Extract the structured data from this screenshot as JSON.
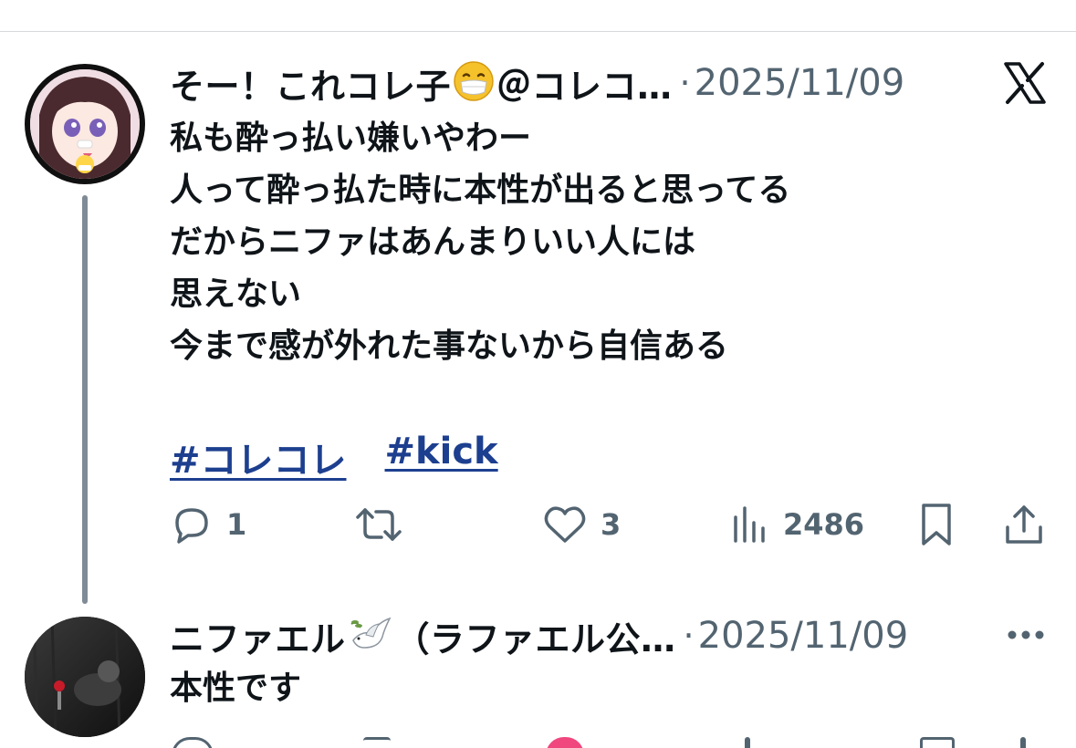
{
  "post1": {
    "display_name": "そー！これコレ子",
    "name_emoji": "mask-face-emoji",
    "handle_truncated": "＠コレコ…",
    "separator": "·",
    "date": "2025/11/09",
    "lines": [
      "私も酔っ払い嫌いやわー",
      "人って酔っ払た時に本性が出ると思ってる",
      "だからニファはあんまりいい人には",
      "思えない",
      "今まで感が外れた事ないから自信ある"
    ],
    "hashtags": [
      "#コレコレ",
      "#kick"
    ],
    "counts": {
      "replies": "1",
      "reposts": "",
      "likes": "3",
      "views": "2486"
    }
  },
  "post2": {
    "display_name": "ニファエル",
    "name_emoji": "dove-emoji",
    "name_suffix": "（ラファエル公…",
    "separator": "·",
    "date": "2025/11/09",
    "lines": [
      "本性です"
    ]
  },
  "icons": {
    "x_logo": "x-logo-icon",
    "more": "more-dots-icon",
    "reply": "reply-icon",
    "repost": "repost-icon",
    "like": "heart-icon",
    "views": "views-bar-icon",
    "bookmark": "bookmark-icon",
    "share": "share-icon"
  },
  "colors": {
    "text": "#0f1419",
    "secondary": "#536471",
    "hashtag": "#1d3f8f",
    "thread_line": "#7f8b97",
    "divider": "#d6d9dc"
  }
}
